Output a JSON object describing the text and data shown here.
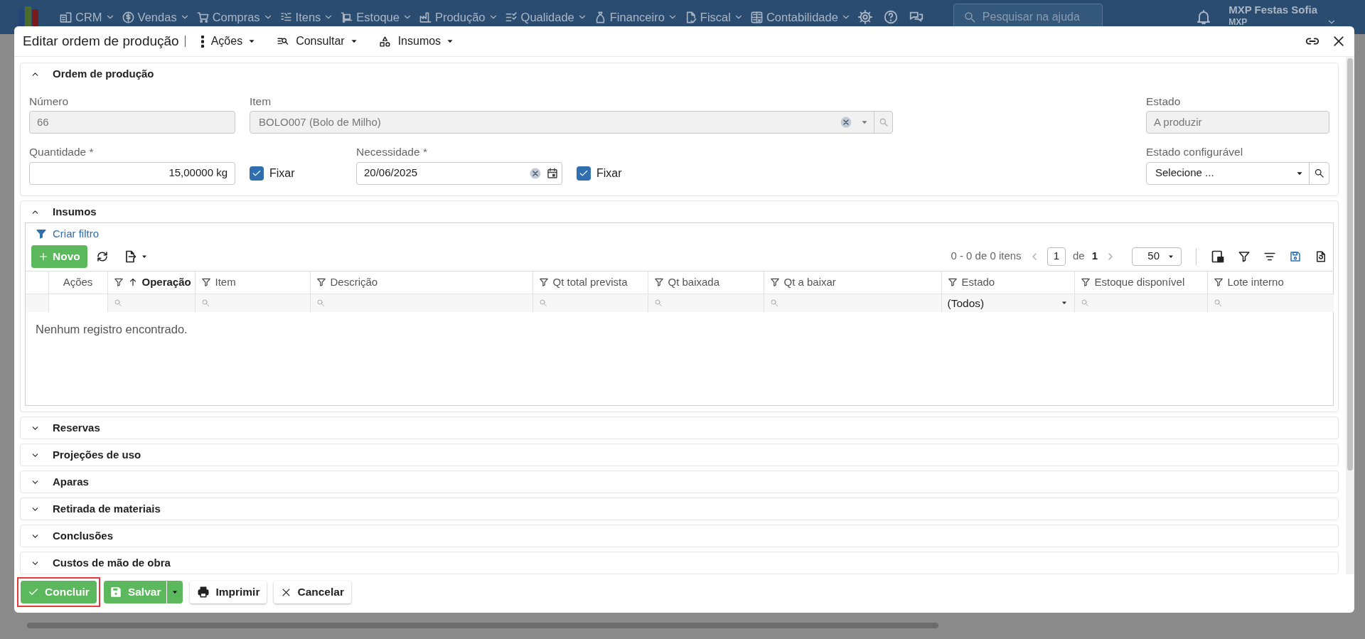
{
  "nav": {
    "menus": [
      {
        "label": "CRM"
      },
      {
        "label": "Vendas"
      },
      {
        "label": "Compras"
      },
      {
        "label": "Itens"
      },
      {
        "label": "Estoque"
      },
      {
        "label": "Produção"
      },
      {
        "label": "Qualidade"
      },
      {
        "label": "Financeiro"
      },
      {
        "label": "Fiscal"
      },
      {
        "label": "Contabilidade"
      }
    ],
    "help_search": {
      "placeholder": "Pesquisar na ajuda"
    },
    "user": {
      "name": "MXP Festas Sofia",
      "company": "MXP"
    }
  },
  "modal": {
    "title": "Editar ordem de produção",
    "menus": [
      {
        "label": "Ações"
      },
      {
        "label": "Consultar"
      },
      {
        "label": "Insumos"
      }
    ]
  },
  "sections": [
    {
      "kind": "form",
      "title": "Ordem de produção",
      "expanded": true,
      "rows": [
        {
          "fields": [
            {
              "kind": "text",
              "label": "Número",
              "value": "66",
              "disabled": true
            },
            {
              "kind": "lookup",
              "label": "Item",
              "value": "BOLO007 (Bolo de Milho)",
              "disabled": true
            },
            {
              "kind": "text",
              "label": "Estado",
              "value": "A produzir",
              "disabled": true
            }
          ]
        },
        {
          "fields": [
            {
              "kind": "number",
              "label": "Quantidade *",
              "value": "15,00000 kg",
              "disabled": false
            },
            {
              "kind": "checkbox",
              "label": "Fixar",
              "checked": true
            },
            {
              "kind": "date",
              "label": "Necessidade *",
              "value": "20/06/2025",
              "disabled": false
            },
            {
              "kind": "checkbox",
              "label": "Fixar",
              "checked": true
            },
            {
              "kind": "select",
              "label": "Estado configurável",
              "value": "Selecione ...",
              "disabled": false
            }
          ]
        }
      ]
    },
    {
      "kind": "grid",
      "title": "Insumos",
      "expanded": true,
      "grid": {
        "filter_link": "Criar filtro",
        "new_button": "Novo",
        "pager": {
          "summary": "0 - 0 de 0 itens",
          "page": "1",
          "of": "de",
          "total_pages": "1",
          "page_size": "50"
        },
        "columns": [
          {
            "label": "Ações",
            "filterable": false,
            "sorted": false,
            "kind": "none"
          },
          {
            "label": "Operação",
            "filterable": true,
            "sorted": true,
            "kind": "search"
          },
          {
            "label": "Item",
            "filterable": true,
            "sorted": false,
            "kind": "search"
          },
          {
            "label": "Descrição",
            "filterable": true,
            "sorted": false,
            "kind": "search"
          },
          {
            "label": "Qt total prevista",
            "filterable": true,
            "sorted": false,
            "kind": "search"
          },
          {
            "label": "Qt baixada",
            "filterable": true,
            "sorted": false,
            "kind": "search"
          },
          {
            "label": "Qt a baixar",
            "filterable": true,
            "sorted": false,
            "kind": "search"
          },
          {
            "label": "Estado",
            "filterable": true,
            "sorted": false,
            "kind": "select",
            "filter_value": "(Todos)"
          },
          {
            "label": "Estoque disponível",
            "filterable": true,
            "sorted": false,
            "kind": "search"
          },
          {
            "label": "Lote interno",
            "filterable": true,
            "sorted": false,
            "kind": "search"
          }
        ],
        "empty_message": "Nenhum registro encontrado."
      }
    },
    {
      "kind": "collapsed",
      "title": "Reservas",
      "expanded": false
    },
    {
      "kind": "collapsed",
      "title": "Projeções de uso",
      "expanded": false
    },
    {
      "kind": "collapsed",
      "title": "Aparas",
      "expanded": false
    },
    {
      "kind": "collapsed",
      "title": "Retirada de materiais",
      "expanded": false
    },
    {
      "kind": "collapsed",
      "title": "Conclusões",
      "expanded": false
    },
    {
      "kind": "collapsed",
      "title": "Custos de mão de obra",
      "expanded": false
    }
  ],
  "footer": {
    "buttons": [
      {
        "label": "Concluir",
        "kind": "success",
        "highlighted": true
      },
      {
        "label": "Salvar",
        "kind": "split",
        "highlighted": false
      },
      {
        "label": "Imprimir",
        "kind": "default",
        "highlighted": false
      },
      {
        "label": "Cancelar",
        "kind": "default",
        "highlighted": false
      }
    ]
  }
}
